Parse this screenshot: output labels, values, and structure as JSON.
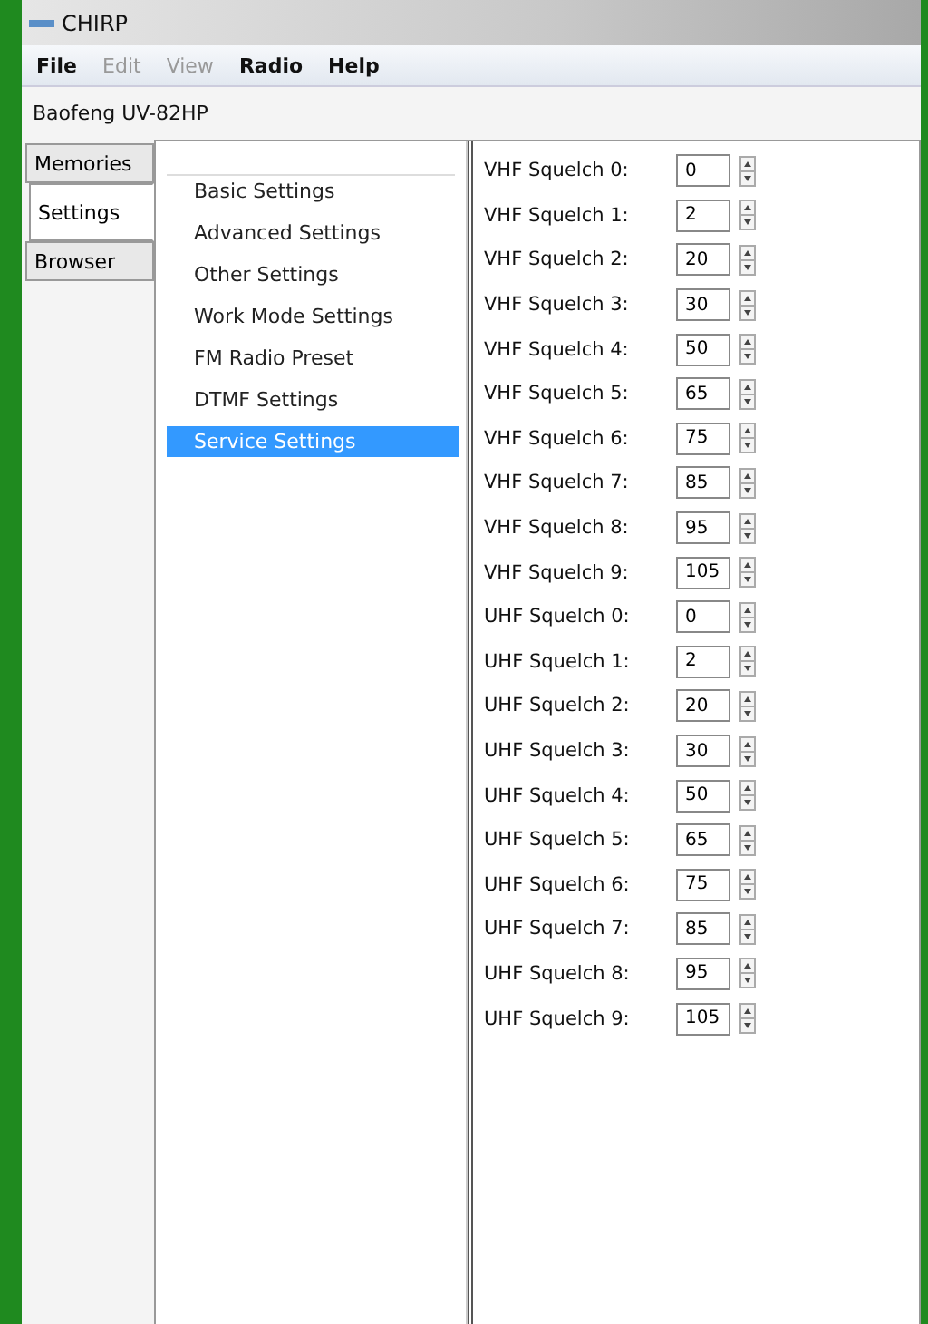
{
  "window": {
    "title": "CHIRP"
  },
  "menu": [
    {
      "label": "File",
      "disabled": false
    },
    {
      "label": "Edit",
      "disabled": true
    },
    {
      "label": "View",
      "disabled": true
    },
    {
      "label": "Radio",
      "disabled": false
    },
    {
      "label": "Help",
      "disabled": false
    }
  ],
  "radio_name": "Baofeng UV-82HP",
  "tabs": [
    {
      "label": "Memories",
      "selected": false
    },
    {
      "label": "Settings",
      "selected": true
    },
    {
      "label": "Browser",
      "selected": false
    }
  ],
  "tree": [
    {
      "label": "Basic Settings",
      "selected": false
    },
    {
      "label": "Advanced Settings",
      "selected": false
    },
    {
      "label": "Other Settings",
      "selected": false
    },
    {
      "label": "Work Mode Settings",
      "selected": false
    },
    {
      "label": "FM Radio Preset",
      "selected": false
    },
    {
      "label": "DTMF Settings",
      "selected": false
    },
    {
      "label": "Service Settings",
      "selected": true
    }
  ],
  "settings": [
    {
      "label": "VHF Squelch 0:",
      "value": "0"
    },
    {
      "label": "VHF Squelch 1:",
      "value": "2"
    },
    {
      "label": "VHF Squelch 2:",
      "value": "20"
    },
    {
      "label": "VHF Squelch 3:",
      "value": "30"
    },
    {
      "label": "VHF Squelch 4:",
      "value": "50"
    },
    {
      "label": "VHF Squelch 5:",
      "value": "65"
    },
    {
      "label": "VHF Squelch 6:",
      "value": "75"
    },
    {
      "label": "VHF Squelch 7:",
      "value": "85"
    },
    {
      "label": "VHF Squelch 8:",
      "value": "95"
    },
    {
      "label": "VHF Squelch 9:",
      "value": "105"
    },
    {
      "label": "UHF Squelch 0:",
      "value": "0"
    },
    {
      "label": "UHF Squelch 1:",
      "value": "2"
    },
    {
      "label": "UHF Squelch 2:",
      "value": "20"
    },
    {
      "label": "UHF Squelch 3:",
      "value": "30"
    },
    {
      "label": "UHF Squelch 4:",
      "value": "50"
    },
    {
      "label": "UHF Squelch 5:",
      "value": "65"
    },
    {
      "label": "UHF Squelch 6:",
      "value": "75"
    },
    {
      "label": "UHF Squelch 7:",
      "value": "85"
    },
    {
      "label": "UHF Squelch 8:",
      "value": "95"
    },
    {
      "label": "UHF Squelch 9:",
      "value": "105"
    }
  ]
}
